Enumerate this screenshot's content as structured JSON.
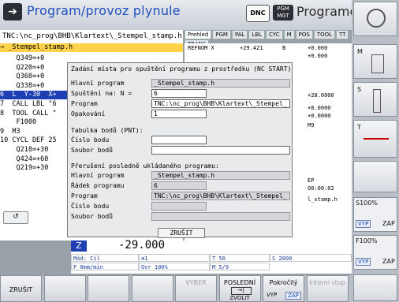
{
  "header": {
    "mode_title": "Program/provoz plynule",
    "dnc_label": "DNC",
    "pgm_line1": "PGM",
    "pgm_line2": "MGT",
    "right_title": "Programování"
  },
  "program": {
    "path": "TNC:\\nc_prog\\BHB\\Klartext\\_Stempel_stamp.h",
    "file_line": "→ _Stempel_stamp.h",
    "lines": [
      {
        "text": "    Q349=+0",
        "style": ""
      },
      {
        "text": "    Q220=+0",
        "style": ""
      },
      {
        "text": "    Q368=+0",
        "style": ""
      },
      {
        "text": "    Q338=+0",
        "style": ""
      },
      {
        "text": "6  L  Y-30  X+",
        "style": "sel"
      },
      {
        "text": "7  CALL LBL \"6",
        "style": ""
      },
      {
        "text": "8  TOOL CALL \"",
        "style": ""
      },
      {
        "text": "    F1000",
        "style": ""
      },
      {
        "text": "9  M3",
        "style": ""
      },
      {
        "text": "10 CYCL DEF 25",
        "style": ""
      },
      {
        "text": "    Q218=+30",
        "style": ""
      },
      {
        "text": "    Q424=+60",
        "style": ""
      },
      {
        "text": "    Q219=+30",
        "style": ""
      }
    ]
  },
  "status": {
    "tabs": [
      "Prehled",
      "PGM",
      "PAL",
      "LBL",
      "CYC",
      "M",
      "POS",
      "TOOL",
      "TT",
      "TRANS"
    ],
    "rows": [
      {
        "a": "REFNOM X",
        "b": "+29.421",
        "c": "B",
        "d": "+0.000"
      },
      {
        "a": "",
        "b": "",
        "c": "",
        "d": "+0.000"
      },
      {
        "a": "",
        "b": "",
        "c": "",
        "d": "+20.0000"
      },
      {
        "a": "",
        "b": "",
        "c": "",
        "d": "+8.0000"
      },
      {
        "a": "",
        "b": "",
        "c": "",
        "d": "+0.0000"
      },
      {
        "a": "",
        "b": "",
        "c": "",
        "d": "M9"
      },
      {
        "a": "",
        "b": "",
        "c": "",
        "d": "EP"
      },
      {
        "a": "",
        "b": "",
        "c": "",
        "d": "00:00:02"
      },
      {
        "a": "",
        "b": "",
        "c": "",
        "d": "l_stamp.h"
      }
    ]
  },
  "dialog": {
    "title": "Zadání místa pro spuštění programu z prostředku (NC START)",
    "main_program_label": "Hlavní program",
    "main_program_value": "_Stempel_stamp.h",
    "start_label": "Spuštění na: N =",
    "start_value": "6",
    "program_label": "Program",
    "program_value": "TNC:\\nc_prog\\BHB\\Klartext\\_Stempel_",
    "repeat_label": "Opakování",
    "repeat_value": "1",
    "table_heading": "Tabulka bodů (PNT):",
    "point_no_label": "Číslo bodu",
    "point_no_value": "",
    "point_file_label": "Soubor bodů",
    "point_file_value": "",
    "interrupt_heading": "Přerušení posledně ukládaného programu:",
    "int_main_label": "Hlavní program",
    "int_main_value": "_Stempel_stamp.h",
    "int_line_label": "Řádek programu",
    "int_line_value": "6",
    "int_program_label": "Program",
    "int_program_value": "TNC:\\nc_prog\\BHB\\Klartext\\_Stempel_",
    "int_point_label": "Číslo bodu",
    "int_point_value": "",
    "int_file_label": "Soubor bodů",
    "int_file_value": "",
    "cancel_label": "ZRUŠIT"
  },
  "axis": {
    "z_label": "Z",
    "z_value": "-29.000",
    "mode_label": "Mód: Cíl",
    "tool_label": "T 50",
    "spindle_label": "S 2000",
    "feed_label": "F 0mm/min",
    "override_label": "Ovr 100%",
    "m_label": "M 5/9"
  },
  "softkeys_bottom": [
    {
      "label": "ZRUŠIT",
      "dim": false
    },
    {
      "label": "",
      "dim": false
    },
    {
      "label": "",
      "dim": false
    },
    {
      "label": "",
      "dim": false
    },
    {
      "label": "VYBER",
      "dim": true
    },
    {
      "label": "POSLEDNÍ",
      "dim": false
    },
    {
      "label": "Pokročilý",
      "dim": false
    },
    {
      "label": "Interní stop",
      "dim": true
    }
  ],
  "softkeys_bottom_extra": {
    "zvolit": "ZVOLIT",
    "vyp": "VYP",
    "zap": "ZAP"
  },
  "right_softkeys": {
    "m_label": "M",
    "s_label": "S",
    "t_label": "T",
    "s100": "S100%",
    "f100": "F100%",
    "vyp": "VYP",
    "zap": "ZAP"
  }
}
